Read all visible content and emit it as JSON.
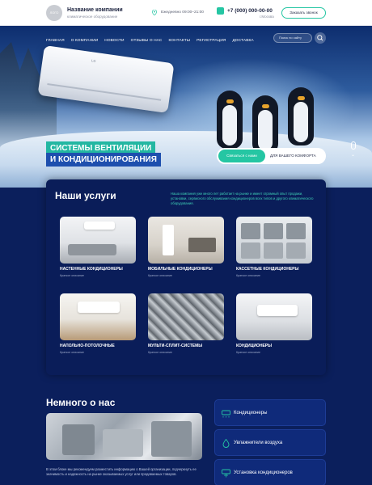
{
  "header": {
    "logo_text": "ЛОГО",
    "company_name": "Название компании",
    "company_sub": "климатическое оборудование",
    "hours": "Ежедневно 09:00–21:00",
    "phone": "+7 (000) 000-00-00",
    "city": "г.Москва",
    "callback_label": "Заказать звонок"
  },
  "nav": {
    "items": [
      "ГЛАВНАЯ",
      "О КОМПАНИИ",
      "НОВОСТИ",
      "ОТЗЫВЫ О НАС",
      "КОНТАКТЫ",
      "РЕГИСТРАЦИЯ",
      "ДОСТАВКА"
    ],
    "search_placeholder": "Поиск по сайту"
  },
  "hero": {
    "headline_1": "СИСТЕМЫ ВЕНТИЛЯЦИИ",
    "headline_2": "И КОНДИЦИОНИРОВАНИЯ",
    "cta_label": "Связаться с нами",
    "cta_text": "ДЛЯ ВАШЕГО КОМФОРТА",
    "ac_brand": "LG"
  },
  "services": {
    "title": "Наши услуги",
    "description": "Наша компания уже много лет работает на рынке и имеет огромный опыт продажи, установки, сервисного обслуживания кондиционеров всех типов и другого климатического оборудования.",
    "cards": [
      {
        "title": "НАСТЕННЫЕ КОНДИЦИОНЕРЫ",
        "subtitle": "Краткое описание"
      },
      {
        "title": "МОБИЛЬНЫЕ КОНДИЦИОНЕРЫ",
        "subtitle": "Краткое описание"
      },
      {
        "title": "КАССЕТНЫЕ КОНДИЦИОНЕРЫ",
        "subtitle": "Краткое описание"
      },
      {
        "title": "НАПОЛЬНО-ПОТОЛОЧНЫЕ",
        "subtitle": "Краткое описание"
      },
      {
        "title": "МУЛЬТИ-СПЛИТ-СИСТЕМЫ",
        "subtitle": "Краткое описание"
      },
      {
        "title": "КОНДИЦИОНЕРЫ",
        "subtitle": "Краткое описание"
      }
    ]
  },
  "about": {
    "title": "Немного о нас",
    "text": "В этом блоке мы рекомендуем разместить информацию о Вашей организации, подчеркнуть ее значимость и надежность на рынке оказываемых услуг или продаваемых товаров.",
    "categories": [
      {
        "label": "Кондиционеры",
        "icon": "air-conditioner-icon"
      },
      {
        "label": "Увлажнители воздуха",
        "icon": "humidifier-icon"
      },
      {
        "label": "Установка кондиционеров",
        "icon": "installation-icon"
      }
    ]
  },
  "colors": {
    "accent": "#25c6a3",
    "navy": "#0b1f5c",
    "blue": "#1e4fae"
  }
}
